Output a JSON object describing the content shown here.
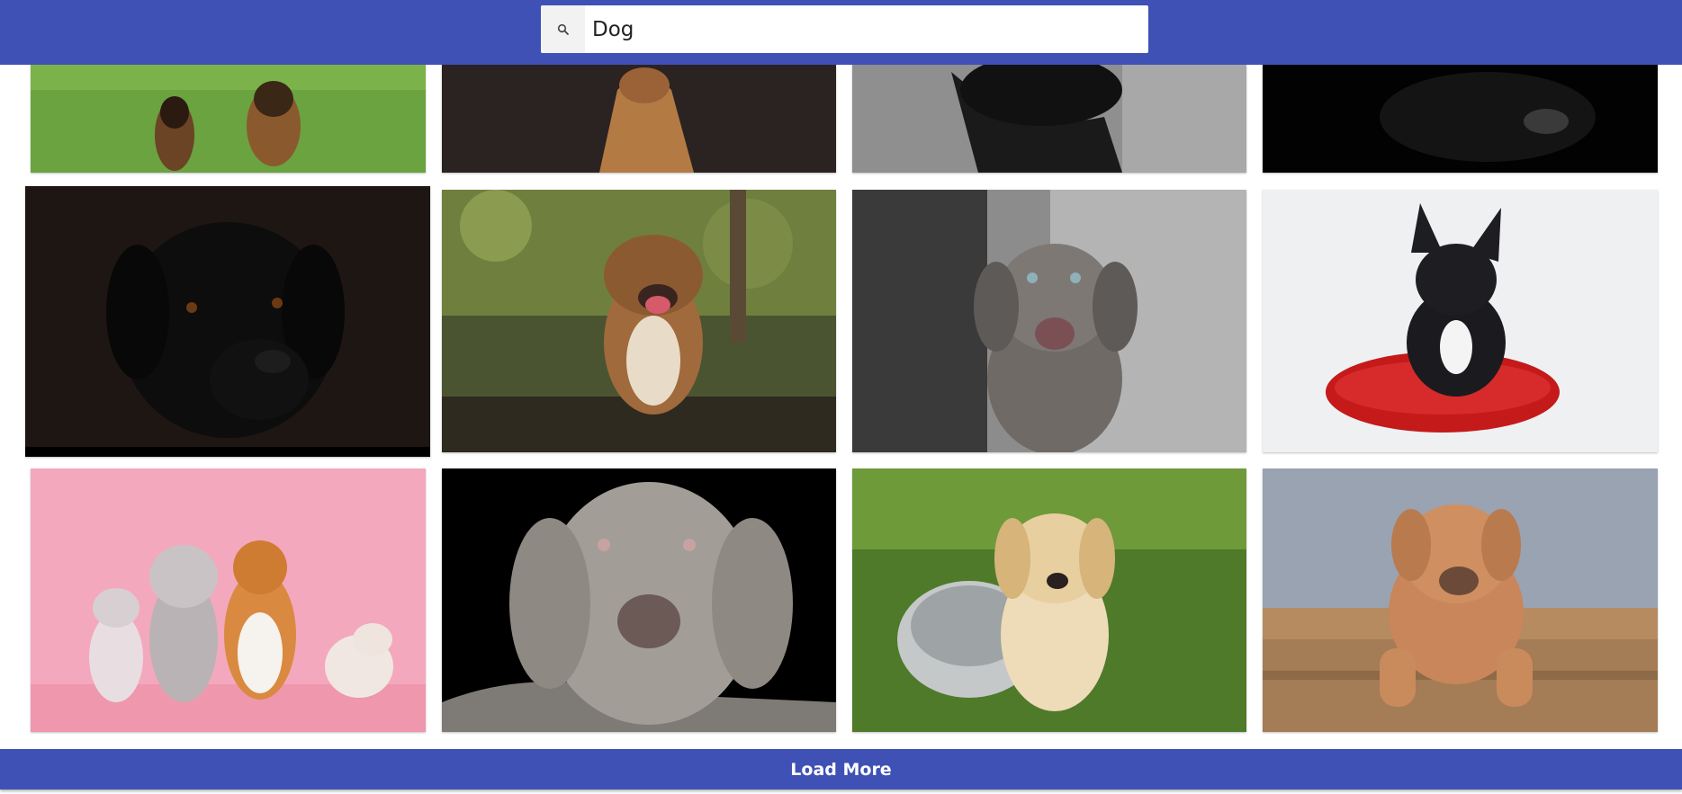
{
  "search": {
    "value": "Dog",
    "icon": "search-icon"
  },
  "gallery": {
    "images": [
      {
        "subject": "two-german-shepherd-puppies-on-grass"
      },
      {
        "subject": "brown-dog-dark-background"
      },
      {
        "subject": "black-dog-grey-background"
      },
      {
        "subject": "black-dog-profile-black-background"
      },
      {
        "subject": "black-labrador-portrait"
      },
      {
        "subject": "english-bulldog-in-forest"
      },
      {
        "subject": "weimaraner-puppy-on-wood"
      },
      {
        "subject": "french-bulldog-on-red-pillow"
      },
      {
        "subject": "cats-poodle-corgi-pink-background"
      },
      {
        "subject": "weimaraner-black-background"
      },
      {
        "subject": "golden-retriever-puppy-in-bowl"
      },
      {
        "subject": "dogue-de-bordeaux-puppy-in-crate"
      }
    ]
  },
  "footer": {
    "load_more_label": "Load More"
  },
  "colors": {
    "primary": "#3f51b5"
  }
}
